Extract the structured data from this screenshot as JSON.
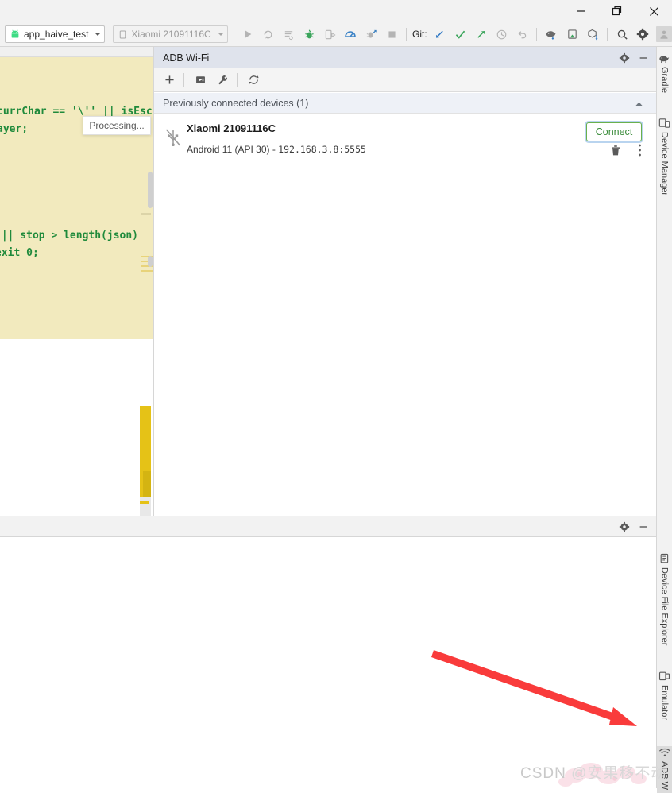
{
  "window": {
    "buttons": {
      "minimize": "minimize",
      "maximize": "restore",
      "close": "close"
    }
  },
  "toolbar": {
    "run_config": "app_haive_test",
    "device_selector": "Xiaomi 21091116C",
    "git_label": "Git:",
    "icons": [
      "run-icon",
      "rerun-icon",
      "run-with-coverage-icon",
      "debug-icon",
      "run-device-icon",
      "profiler-icon",
      "attach-debugger-icon",
      "stop-icon",
      "git-update-icon",
      "git-commit-icon",
      "git-push-icon",
      "history-icon",
      "undo-icon",
      "gradle-sync-icon",
      "avd-manager-icon",
      "sdk-manager-icon",
      "search-icon",
      "settings-icon",
      "avatar-icon"
    ]
  },
  "editor": {
    "code_lines": [
      "currChar == '\\'' || isEsc",
      "ayer;",
      " || stop > length(json)",
      "exit 0;"
    ],
    "tooltip": "Processing..."
  },
  "adb_panel": {
    "title": "ADB Wi-Fi",
    "header_icons": [
      "gear-icon",
      "minimize-icon"
    ],
    "toolbar_icons": [
      "add-icon",
      "pair-icon",
      "wrench-icon",
      "refresh-icon"
    ],
    "section_header": "Previously connected devices (1)",
    "device": {
      "name": "Xiaomi 21091116C",
      "android_version": "Android 11 (API 30) - ",
      "address": "192.168.3.8:5555",
      "connect_label": "Connect",
      "status_icon": "usb-disconnected-icon",
      "row_icons": [
        "delete-icon",
        "more-options-icon"
      ]
    }
  },
  "bottom_panel": {
    "icons": [
      "gear-icon",
      "minimize-icon"
    ]
  },
  "right_tool_strip": {
    "items": [
      {
        "label": "Gradle",
        "icon": "gradle-elephant-icon"
      },
      {
        "label": "Device Manager",
        "icon": "device-manager-icon"
      },
      {
        "label": "Device File Explorer",
        "icon": "device-file-explorer-icon"
      },
      {
        "label": "Emulator",
        "icon": "emulator-icon"
      },
      {
        "label": "ADB W",
        "icon": "adb-wifi-icon"
      }
    ]
  },
  "annotation": {
    "arrow_color": "#f93b3b"
  },
  "watermark": {
    "prefix": "CSDN ",
    "handle": "@安果移不动"
  }
}
